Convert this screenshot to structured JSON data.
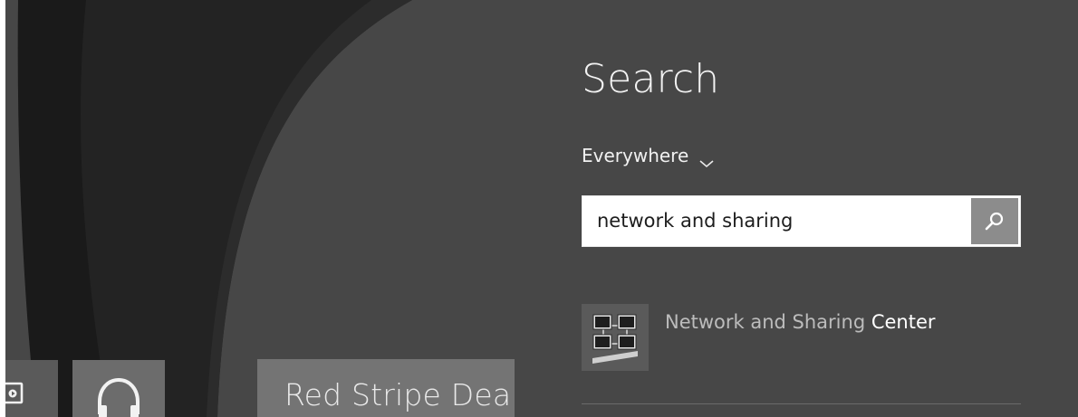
{
  "start_screen": {
    "tiles": {
      "video": {
        "icon": "video-icon"
      },
      "music": {
        "icon": "headphones-icon"
      },
      "game": {
        "label": "Red Stripe Dea"
      }
    }
  },
  "search_pane": {
    "title": "Search",
    "scope": {
      "label": "Everywhere",
      "icon": "chevron-down-icon"
    },
    "search_box": {
      "value": "network and sharing",
      "button_icon": "search-icon"
    },
    "results": [
      {
        "icon": "network-sharing-icon",
        "label_match": "Network and Sharing",
        "label_rest": "Center"
      }
    ]
  },
  "colors": {
    "pane_background": "#474747",
    "start_background": "#4a4a4a",
    "search_button": "#8c8c8c",
    "highlight_text": "#ffffff",
    "muted_text": "#bcbcbc"
  }
}
